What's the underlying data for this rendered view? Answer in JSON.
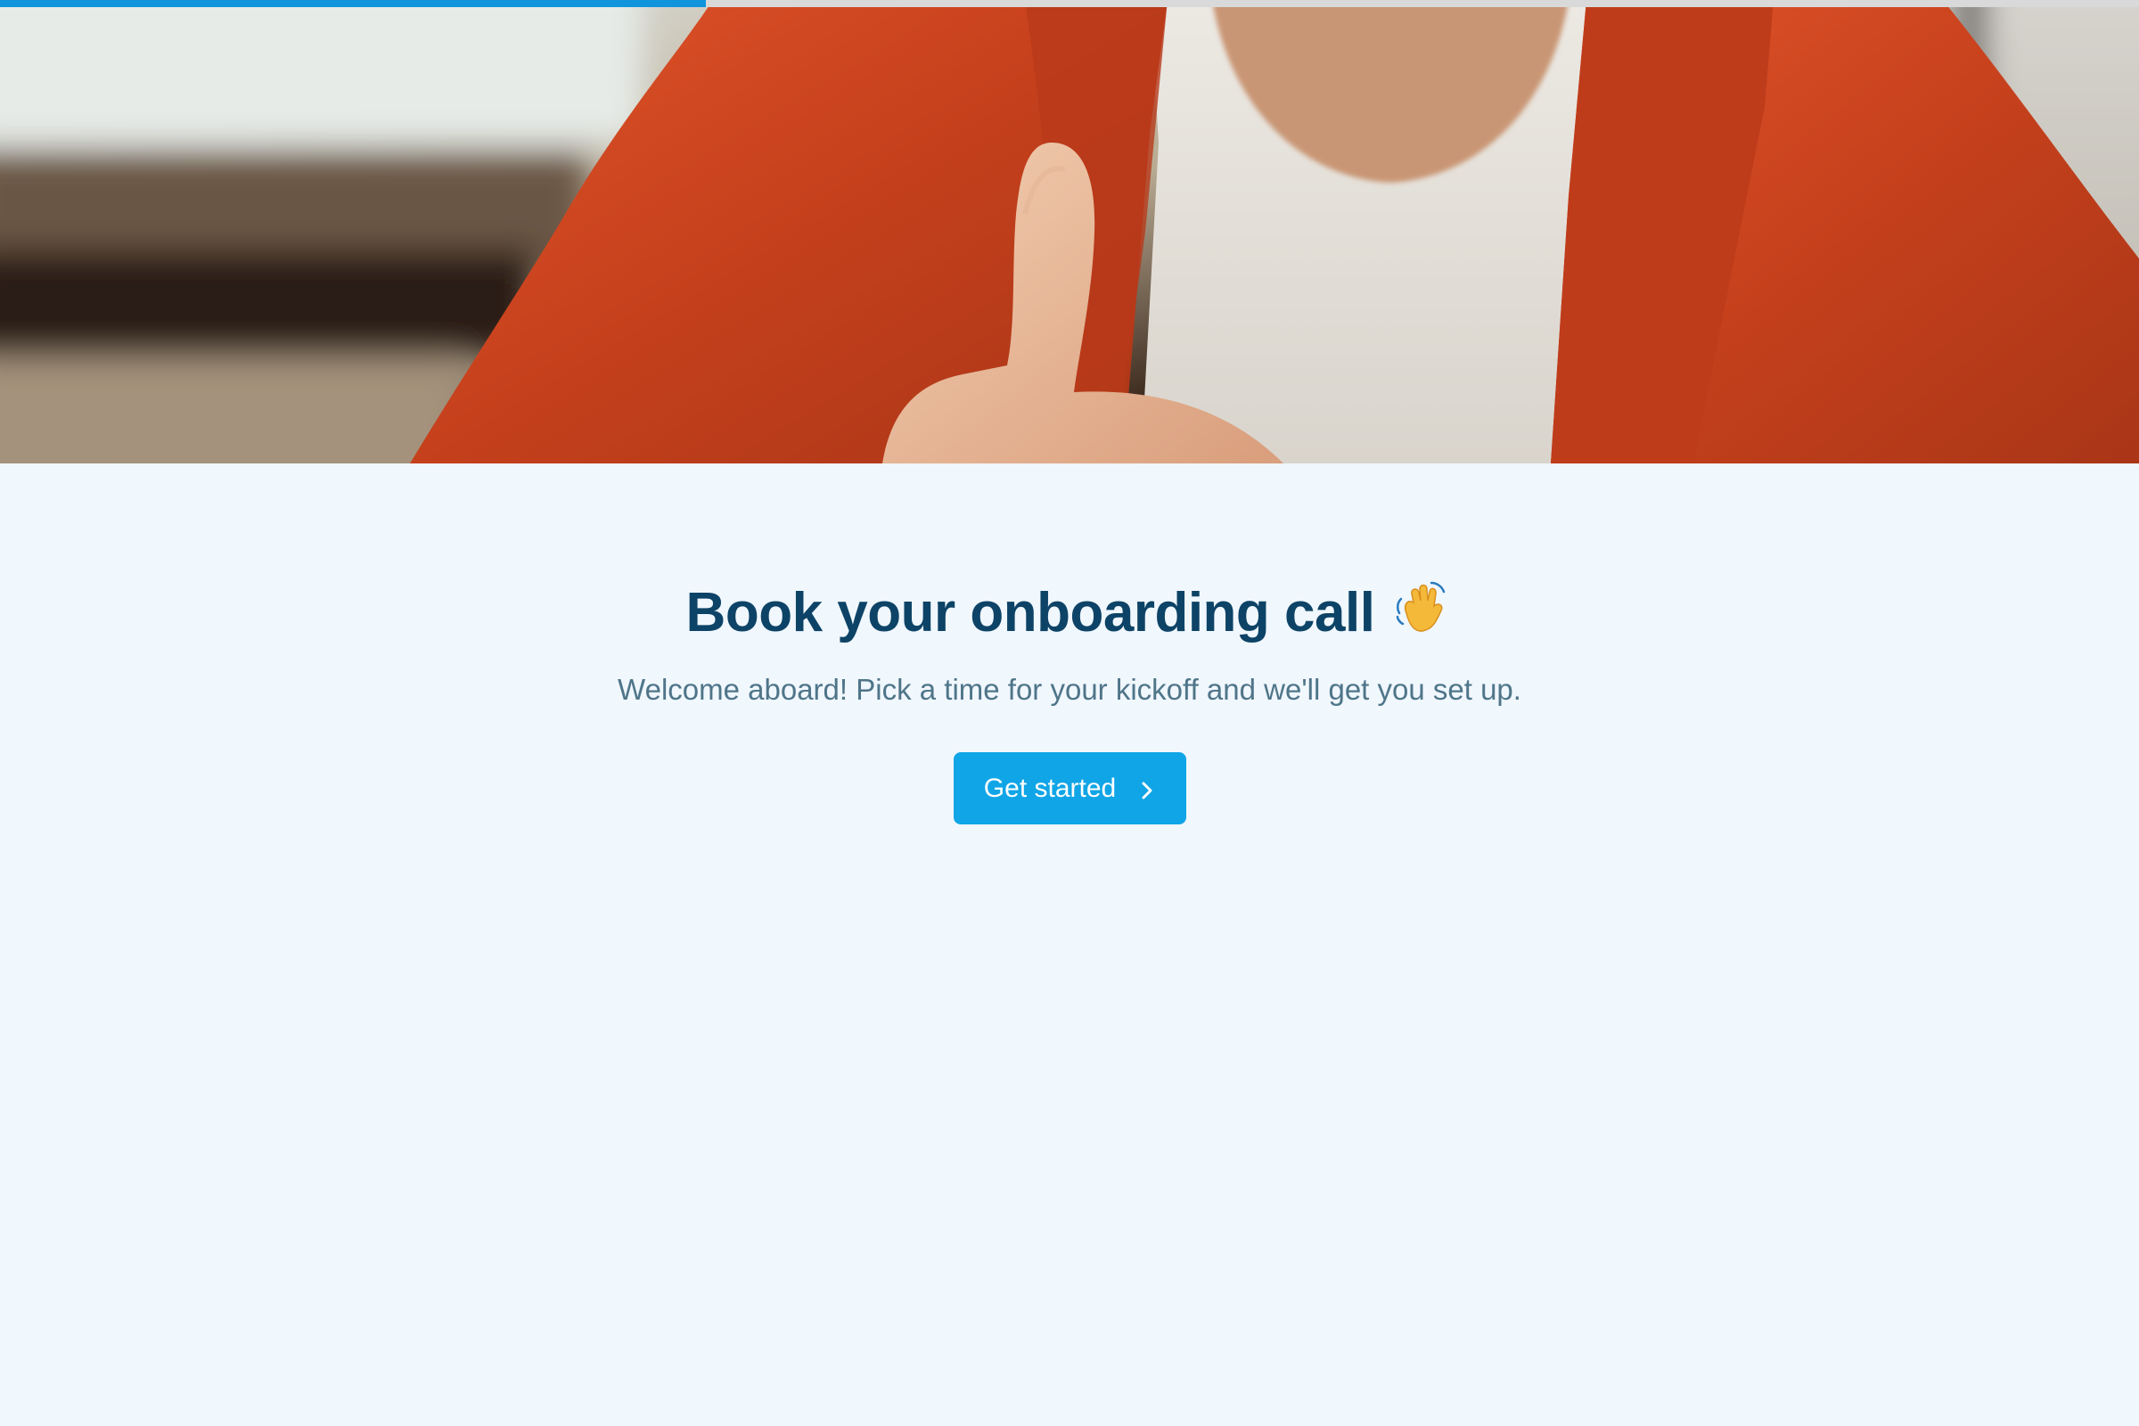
{
  "progress": {
    "fraction": 0.33,
    "color": "#1095dd"
  },
  "hero": {
    "image": "person-in-red-blazer-thumbs-up"
  },
  "main": {
    "title": "Book your onboarding call",
    "title_icon": "waving-hand-icon",
    "subtitle": "Welcome aboard! Pick a time for your kickoff and we'll get you set up.",
    "cta_label": "Get started",
    "cta_icon": "chevron-right-icon"
  },
  "colors": {
    "background": "#f0f7fd",
    "title": "#0d4366",
    "subtitle": "#4f7589",
    "accent": "#10a5e6"
  }
}
